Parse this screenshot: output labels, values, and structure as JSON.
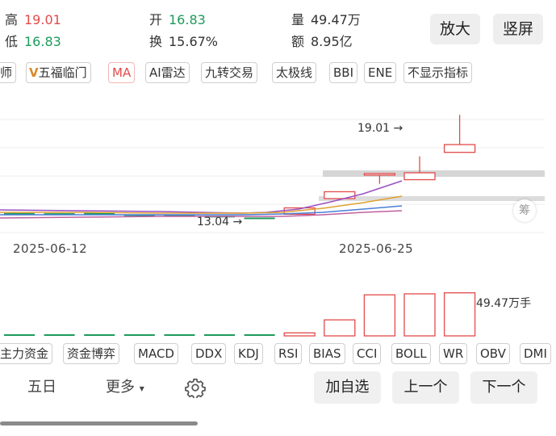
{
  "quote": {
    "high_label": "高",
    "high_value": "19.01",
    "low_label": "低",
    "low_value": "16.83",
    "open_label": "开",
    "open_value": "16.83",
    "turnover_label": "换",
    "turnover_value": "15.67%",
    "volume_label": "量",
    "volume_value": "49.47万",
    "amount_label": "额",
    "amount_value": "8.95亿"
  },
  "header_buttons": {
    "zoom": "放大",
    "portrait": "竖屏"
  },
  "indicator_chips_top": [
    "师",
    "五福临门",
    "MA",
    "AI雷达",
    "九转交易",
    "太极线",
    "BBI",
    "ENE",
    "不显示指标"
  ],
  "active_chip": "MA",
  "chip_v_mark": "V",
  "price_chart": {
    "dates": [
      "2025-06-12",
      "2025-06-25"
    ],
    "max_annotation": "19.01",
    "min_annotation": "13.04",
    "arrow": "→",
    "chip_distribution_label": "筹"
  },
  "volume_chart": {
    "current_volume_label": "49.47万手"
  },
  "indicator_chips_bottom": [
    "主力资金",
    "资金博弈",
    "MACD",
    "DDX",
    "KDJ",
    "RSI",
    "BIAS",
    "CCI",
    "BOLL",
    "WR",
    "OBV",
    "DMI"
  ],
  "bottom_nav": {
    "five_day": "五日",
    "more": "更多",
    "more_caret": "▾",
    "add_watch": "加自选",
    "prev": "上一个",
    "next": "下一个"
  },
  "chart_data": {
    "type": "candlestick",
    "x_ticks": [
      "2025-06-12",
      "2025-06-25"
    ],
    "candles": [
      {
        "open": 13.3,
        "close": 13.28
      },
      {
        "open": 13.29,
        "close": 13.27
      },
      {
        "open": 13.35,
        "close": 13.18
      },
      {
        "open": 13.22,
        "close": 13.2
      },
      {
        "open": 13.2,
        "close": 13.18
      },
      {
        "open": 13.14,
        "close": 13.12
      },
      {
        "open": 13.04,
        "close": 12.95
      },
      {
        "open": 13.23,
        "close": 13.6
      },
      {
        "open": 14.14,
        "close": 14.54
      },
      {
        "open": 15.6,
        "close": 15.6,
        "low": 15.0,
        "high": 15.6
      },
      {
        "open": 15.24,
        "close": 15.64,
        "high": 16.6
      },
      {
        "open": 16.83,
        "close": 17.28,
        "low": 16.83,
        "high": 19.01
      }
    ],
    "volume_latest": "49.47万手",
    "colors": {
      "up": "#e24a4a",
      "down": "#1d9a5b",
      "ma5": "#9a4fc4",
      "ma10": "#e0a030",
      "ma20": "#4a7fd6",
      "ma30": "#c060a0"
    }
  }
}
